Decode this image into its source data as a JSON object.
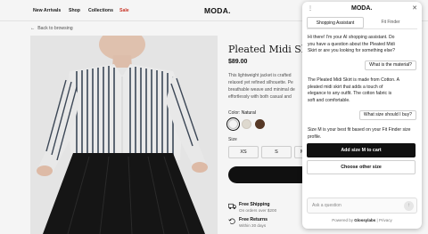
{
  "brand": "MODA.",
  "nav": {
    "links": [
      {
        "label": "New Arrivals"
      },
      {
        "label": "Shop"
      },
      {
        "label": "Collections"
      },
      {
        "label": "Sale"
      }
    ]
  },
  "back_link": "Back to browsing",
  "product": {
    "title": "Pleated Midi Skirt",
    "price": "$89.00",
    "description_lines": [
      "This lightweight jacket is crafted",
      "relaxed yet refined silhouette. Pe",
      "breathable weave and minimal de",
      "effortlessly with both casual and"
    ],
    "color_label": "Color:",
    "color_value": "Natural",
    "swatches": [
      {
        "name": "Natural",
        "color": "#ffffff",
        "selected": true
      },
      {
        "name": "Light",
        "color": "#e8e2d8",
        "selected": false
      },
      {
        "name": "Brown",
        "color": "#5a3b28",
        "selected": false
      }
    ],
    "size_label": "Size",
    "sizes": [
      {
        "label": "XS"
      },
      {
        "label": "S"
      },
      {
        "label": "M"
      }
    ],
    "features": [
      {
        "icon": "truck-icon",
        "title": "Free Shipping",
        "subtitle": "On orders over $200"
      },
      {
        "icon": "return-icon",
        "title": "Free Returns",
        "subtitle": "Within 30 days"
      }
    ]
  },
  "chat": {
    "brand": "MODA.",
    "tabs": [
      {
        "label": "Shopping Assistant",
        "active": true
      },
      {
        "label": "Fit Finder",
        "active": false
      }
    ],
    "messages": [
      {
        "from": "assistant",
        "lines": [
          "Hi there! I'm your AI shopping assistant. Do",
          "you have a question about the Pleated Midi",
          "Skirt or are you looking for something else?"
        ]
      },
      {
        "from": "user",
        "text": "What is the material?"
      },
      {
        "from": "assistant",
        "lines": [
          "The Pleated Midi Skirt is made from Cotton. A",
          "pleated midi skirt that adds a touch of",
          "elegance to any outfit. The cotton fabric is",
          "soft and comfortable."
        ]
      },
      {
        "from": "user",
        "text": "What size should I buy?"
      },
      {
        "from": "assistant",
        "lines": [
          "Size M is your best fit based on your Fit Finder size",
          "profile."
        ]
      }
    ],
    "primary_action": "Add size M to cart",
    "secondary_action": "Choose other size",
    "input_placeholder": "Ask a question",
    "powered_prefix": "Powered by",
    "powered_name": "Glossylabs",
    "powered_sep": "|",
    "powered_link": "Privacy"
  }
}
